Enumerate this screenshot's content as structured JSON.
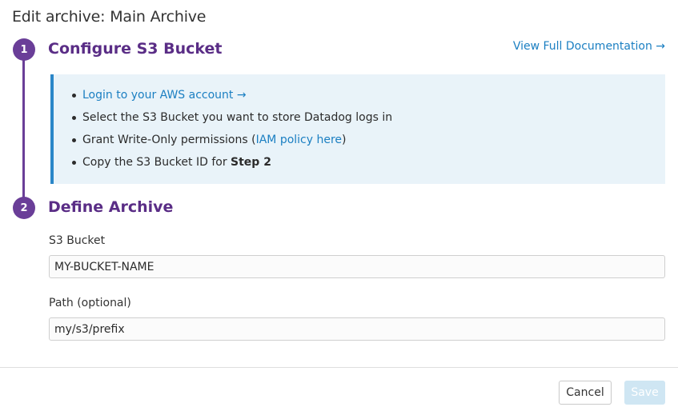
{
  "dialog": {
    "title": "Edit archive: Main Archive"
  },
  "steps": [
    {
      "number": "1",
      "title": "Configure S3 Bucket"
    },
    {
      "number": "2",
      "title": "Define Archive"
    }
  ],
  "documentation_link": "View Full Documentation →",
  "instructions": {
    "login_link": "Login to your AWS account →",
    "select_bucket": "Select the S3 Bucket you want to store Datadog logs in",
    "grant_prefix": "Grant Write-Only permissions (",
    "iam_link": "IAM policy here",
    "grant_suffix": ")",
    "copy_prefix": "Copy the S3 Bucket ID for ",
    "copy_bold": "Step 2"
  },
  "form": {
    "bucket_label": "S3 Bucket",
    "bucket_value": "MY-BUCKET-NAME",
    "path_label": "Path (optional)",
    "path_value": "my/s3/prefix"
  },
  "footer": {
    "cancel_label": "Cancel",
    "save_label": "Save"
  },
  "colors": {
    "accent_purple": "#6a3e98",
    "link_blue": "#1b7fc2",
    "info_background": "#e9f3f9",
    "save_disabled": "#cfe6f3"
  }
}
